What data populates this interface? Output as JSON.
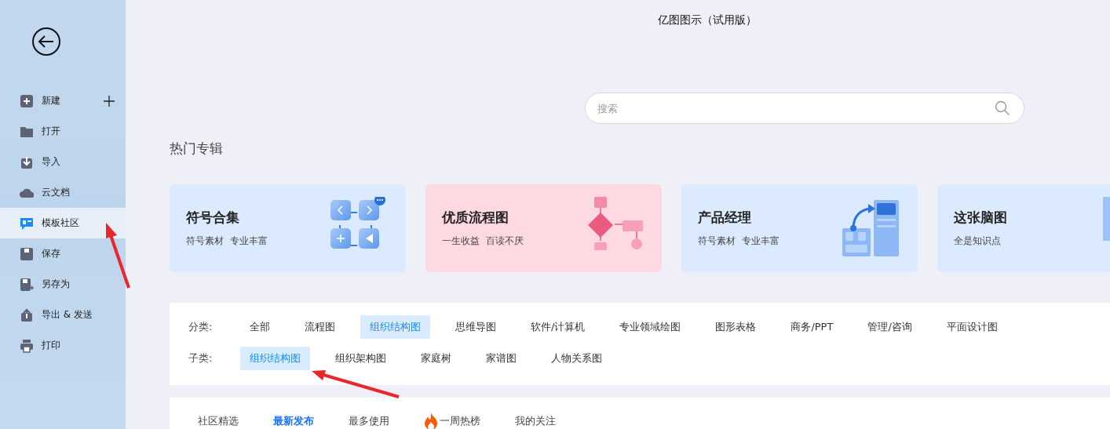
{
  "window": {
    "title": "亿图图示（试用版）"
  },
  "sidebar": {
    "items": [
      {
        "label": "新建",
        "kind": "new",
        "selected": false
      },
      {
        "label": "打开",
        "kind": "open",
        "selected": false
      },
      {
        "label": "导入",
        "kind": "import",
        "selected": false
      },
      {
        "label": "云文档",
        "kind": "cloud",
        "selected": false
      },
      {
        "label": "模板社区",
        "kind": "template",
        "selected": true
      },
      {
        "label": "保存",
        "kind": "save",
        "selected": false
      },
      {
        "label": "另存为",
        "kind": "saveas",
        "selected": false
      },
      {
        "label": "导出 & 发送",
        "kind": "export",
        "selected": false
      },
      {
        "label": "打印",
        "kind": "print",
        "selected": false
      }
    ]
  },
  "search": {
    "placeholder": "搜索"
  },
  "featured": {
    "heading": "热门专辑",
    "cards": [
      {
        "title": "符号合集",
        "subtitle": "符号素材  专业丰富",
        "kind": "symbols"
      },
      {
        "title": "优质流程图",
        "subtitle": "一生收益  百读不厌",
        "kind": "flow"
      },
      {
        "title": "产品经理",
        "subtitle": "符号素材  专业丰富",
        "kind": "product"
      },
      {
        "title": "这张脑图",
        "subtitle": "全是知识点",
        "kind": "mind"
      }
    ]
  },
  "filters": {
    "category": {
      "label": "分类:",
      "options": [
        {
          "label": "全部",
          "selected": false
        },
        {
          "label": "流程图",
          "selected": false
        },
        {
          "label": "组织结构图",
          "selected": true
        },
        {
          "label": "思维导图",
          "selected": false
        },
        {
          "label": "软件/计算机",
          "selected": false
        },
        {
          "label": "专业领域绘图",
          "selected": false
        },
        {
          "label": "图形表格",
          "selected": false
        },
        {
          "label": "商务/PPT",
          "selected": false
        },
        {
          "label": "管理/咨询",
          "selected": false
        },
        {
          "label": "平面设计图",
          "selected": false
        }
      ]
    },
    "subcategory": {
      "label": "子类:",
      "options": [
        {
          "label": "组织结构图",
          "selected": true
        },
        {
          "label": "组织架构图",
          "selected": false
        },
        {
          "label": "家庭树",
          "selected": false
        },
        {
          "label": "家谱图",
          "selected": false
        },
        {
          "label": "人物关系图",
          "selected": false
        }
      ]
    }
  },
  "feed_tabs": [
    {
      "label": "社区精选",
      "selected": false,
      "hot": false
    },
    {
      "label": "最新发布",
      "selected": true,
      "hot": false
    },
    {
      "label": "最多使用",
      "selected": false,
      "hot": false
    },
    {
      "label": "一周热榜",
      "selected": false,
      "hot": true
    },
    {
      "label": "我的关注",
      "selected": false,
      "hot": false
    }
  ]
}
